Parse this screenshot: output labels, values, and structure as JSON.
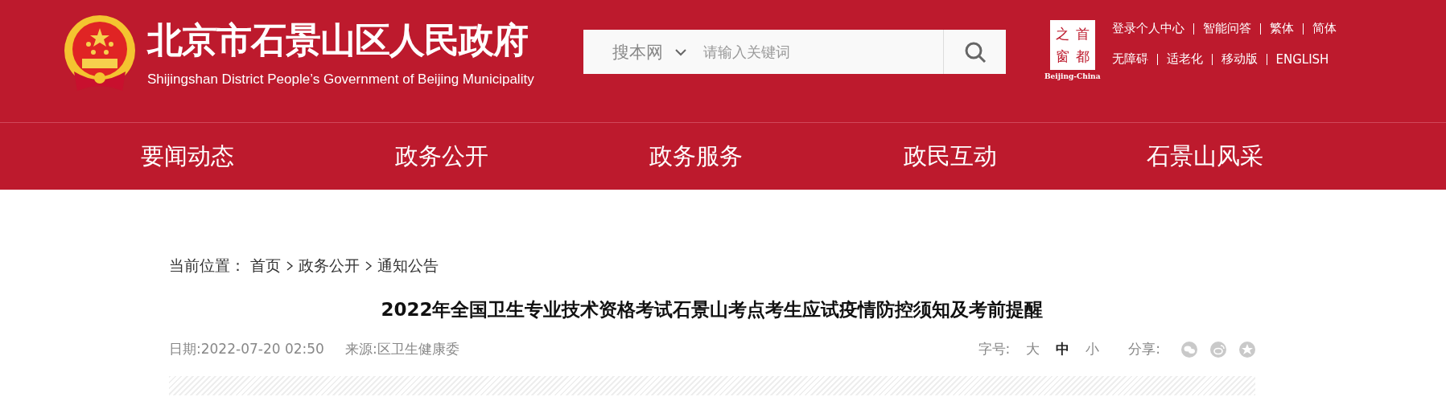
{
  "header": {
    "site_title": "北京市石景山区人民政府",
    "site_subtitle": "Shijingshan District People’s Government of Beijing Municipality",
    "search": {
      "scope": "搜本网",
      "placeholder": "请输入关键词"
    },
    "partner_logo": {
      "characters": [
        "之",
        "首",
        "窗",
        "都"
      ],
      "caption": "Beijing-China"
    },
    "links": [
      [
        "登录个人中心",
        "智能问答",
        "繁体",
        "简体"
      ],
      [
        "无障碍",
        "适老化",
        "移动版",
        "ENGLISH"
      ]
    ]
  },
  "nav": [
    "要闻动态",
    "政务公开",
    "政务服务",
    "政民互动",
    "石景山风采"
  ],
  "breadcrumb": {
    "label": "当前位置：",
    "items": [
      "首页",
      "政务公开",
      "通知公告"
    ]
  },
  "article": {
    "title": "2022年全国卫生专业技术资格考试石景山考点考生应试疫情防控须知及考前提醒",
    "date": "日期:2022-07-20 02:50",
    "source": "来源:区卫生健康委",
    "font_size": {
      "label": "字号:",
      "options": [
        {
          "label": "大",
          "selected": false
        },
        {
          "label": "中",
          "selected": true
        },
        {
          "label": "小",
          "selected": false
        }
      ]
    },
    "share": {
      "label": "分享:",
      "targets": [
        {
          "kind": "wechat"
        },
        {
          "kind": "weibo"
        },
        {
          "kind": "qzone"
        }
      ]
    }
  }
}
